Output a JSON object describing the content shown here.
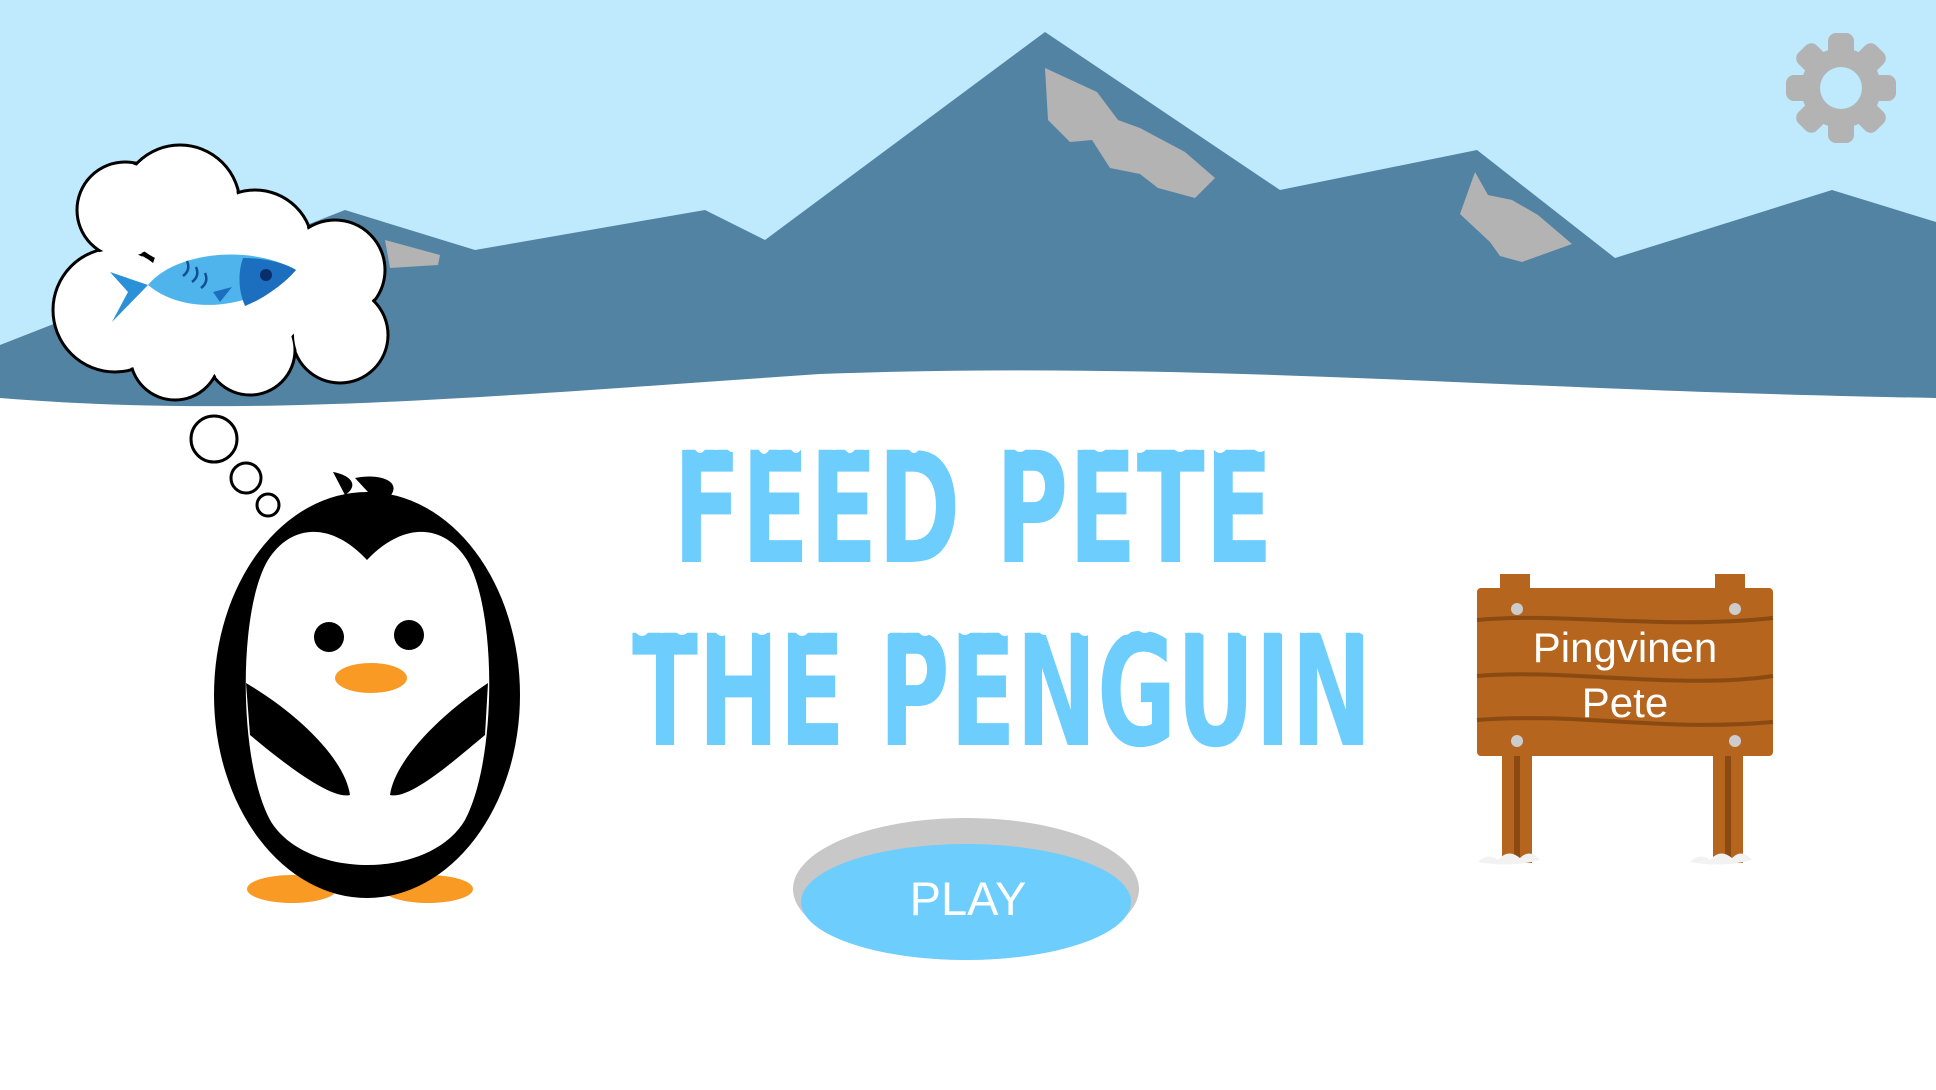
{
  "title": {
    "line1": "FEED PETE",
    "line2": "THE PENGUIN"
  },
  "play_button": {
    "label": "PLAY"
  },
  "sign": {
    "line1": "Pingvinen",
    "line2": "Pete"
  },
  "settings": {
    "icon": "gear-icon"
  },
  "thought_bubble": {
    "icon": "fish-icon"
  },
  "colors": {
    "sky": "#bfe9fc",
    "mountain": "#5283a3",
    "rock": "#b3b3b3",
    "snow": "#ffffff",
    "title": "#6dcdfc",
    "water": "#6dcdfc",
    "wood": "#b5651d",
    "beak": "#f99a25",
    "gear": "#b3b3b3"
  }
}
